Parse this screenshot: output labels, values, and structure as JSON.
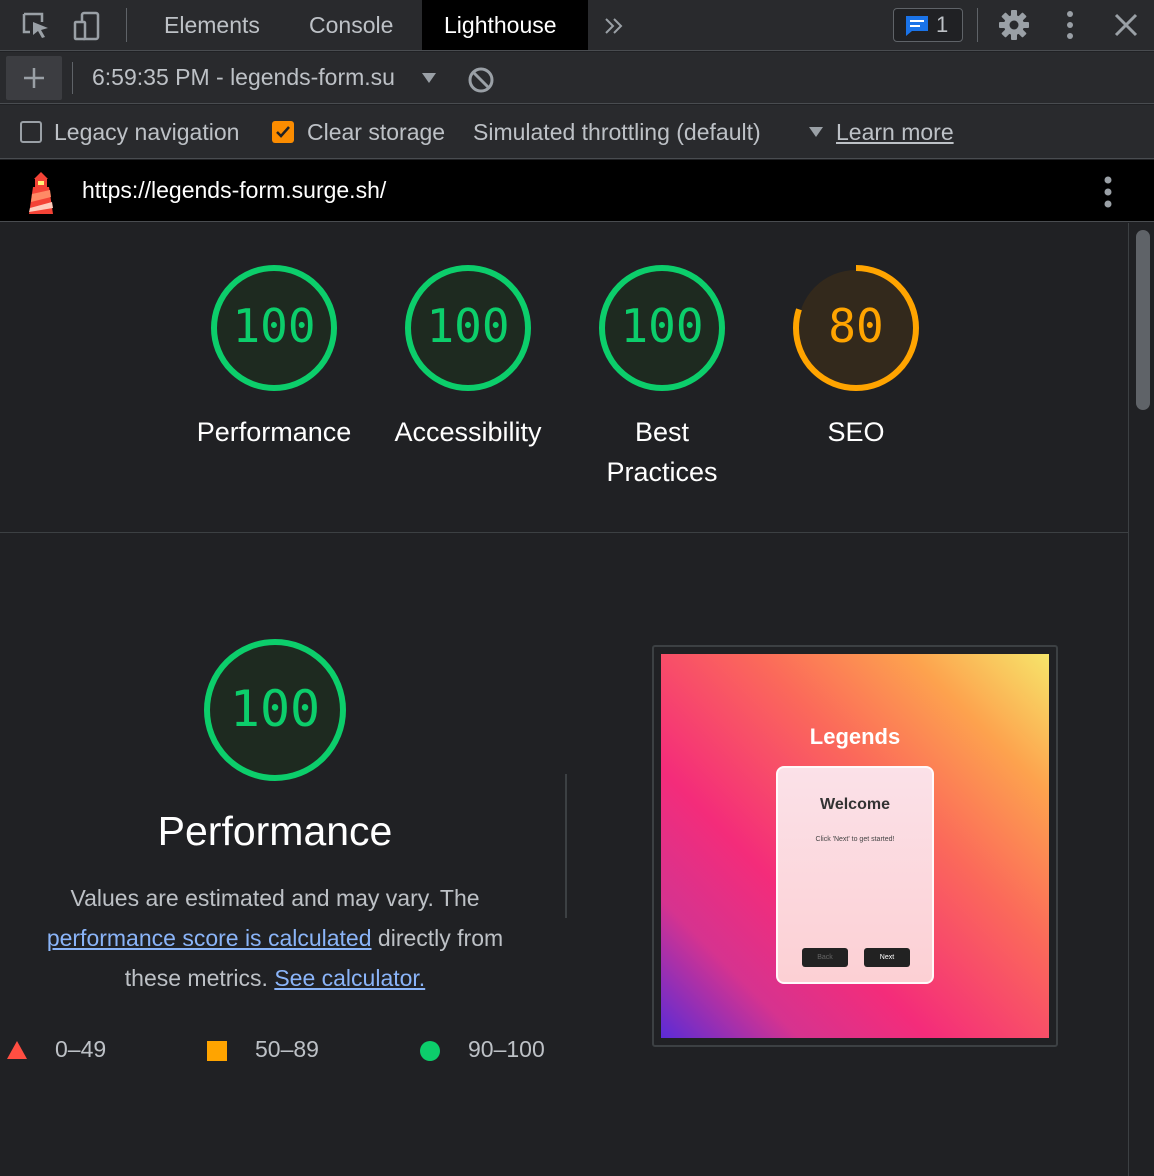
{
  "tabs": [
    {
      "label": "Elements"
    },
    {
      "label": "Console"
    },
    {
      "label": "Lighthouse"
    }
  ],
  "issues_count": "1",
  "toolbar": {
    "report_label": "6:59:35 PM - legends-form.su"
  },
  "options": {
    "legacy_navigation": {
      "label": "Legacy navigation",
      "checked": false
    },
    "clear_storage": {
      "label": "Clear storage",
      "checked": true
    },
    "throttling": "Simulated throttling (default)",
    "learn_more": "Learn more"
  },
  "url": "https://legends-form.surge.sh/",
  "scores": [
    {
      "label": "Performance",
      "score": "100",
      "status": "pass"
    },
    {
      "label": "Accessibility",
      "score": "100",
      "status": "pass"
    },
    {
      "label": "Best Practices",
      "label_line1": "Best",
      "label_line2": "Practices",
      "score": "100",
      "status": "pass"
    },
    {
      "label": "SEO",
      "score": "80",
      "status": "average"
    }
  ],
  "performance": {
    "score": "100",
    "title": "Performance",
    "desc_1": "Values are estimated and may vary. The",
    "desc_link_1": "performance score is calculated",
    "desc_2": "directly from these metrics.",
    "desc_link_2": "See calculator."
  },
  "legend": [
    {
      "range": "0–49",
      "shape": "triangle",
      "color": "#ff4e42"
    },
    {
      "range": "50–89",
      "shape": "square",
      "color": "#ffa400"
    },
    {
      "range": "90–100",
      "shape": "circle",
      "color": "#0cce6b"
    }
  ],
  "screenshot": {
    "title": "Legends",
    "welcome": "Welcome",
    "subtitle": "Click 'Next' to get started!",
    "back": "Back",
    "next": "Next"
  },
  "colors": {
    "pass": "#0cce6b",
    "average": "#ffa400",
    "link": "#8ab4f8"
  }
}
